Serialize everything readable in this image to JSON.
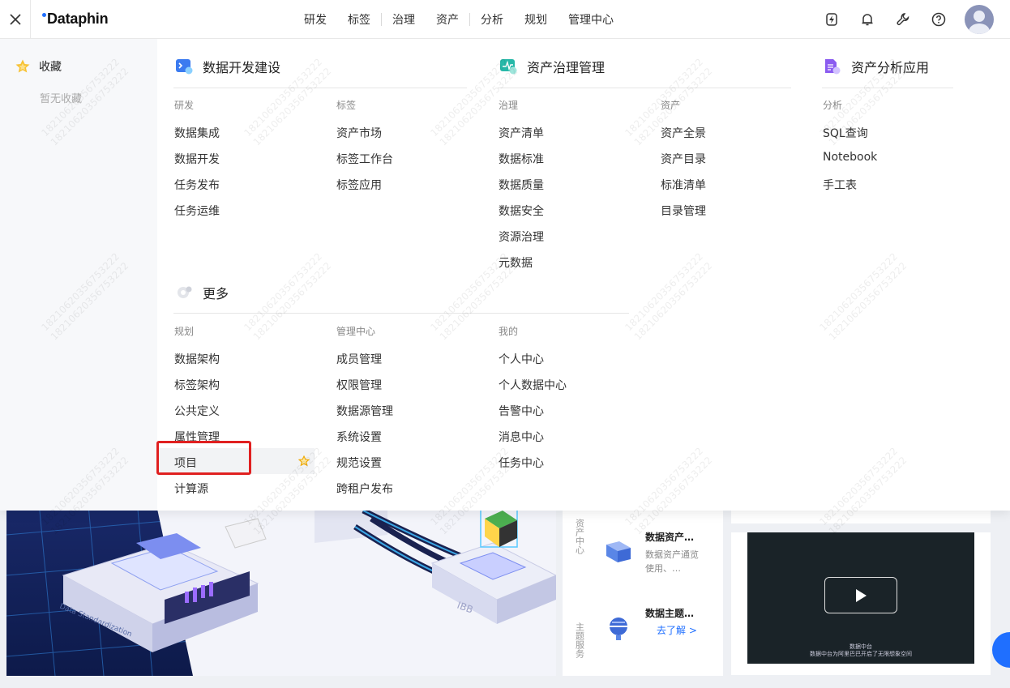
{
  "brand": {
    "logo_text": "Dataphin",
    "accent": "#1f6fff"
  },
  "nav": {
    "items": [
      "研发",
      "标签",
      "治理",
      "资产",
      "分析",
      "规划",
      "管理中心"
    ]
  },
  "top_icons": [
    "lightning-badge-icon",
    "bell-icon",
    "wrench-icon",
    "help-icon",
    "user-avatar"
  ],
  "favorites": {
    "title": "收藏",
    "empty_text": "暂无收藏"
  },
  "sections": {
    "dev": {
      "title": "数据开发建设",
      "groups": [
        {
          "label": "研发",
          "items": [
            "数据集成",
            "数据开发",
            "任务发布",
            "任务运维"
          ]
        },
        {
          "label": "标签",
          "items": [
            "资产市场",
            "标签工作台",
            "标签应用"
          ]
        }
      ]
    },
    "governance": {
      "title": "资产治理管理",
      "groups": [
        {
          "label": "治理",
          "items": [
            "资产清单",
            "数据标准",
            "数据质量",
            "数据安全",
            "资源治理",
            "元数据"
          ]
        },
        {
          "label": "资产",
          "items": [
            "资产全景",
            "资产目录",
            "标准清单",
            "目录管理"
          ]
        }
      ]
    },
    "analysis": {
      "title": "资产分析应用",
      "groups": [
        {
          "label": "分析",
          "items": [
            "SQL查询",
            "Notebook",
            "手工表"
          ]
        }
      ]
    },
    "more": {
      "title": "更多",
      "groups": [
        {
          "label": "规划",
          "items": [
            "数据架构",
            "标签架构",
            "公共定义",
            "属性管理",
            "项目",
            "计算源"
          ]
        },
        {
          "label": "管理中心",
          "items": [
            "成员管理",
            "权限管理",
            "数据源管理",
            "系统设置",
            "规范设置",
            "跨租户发布"
          ]
        },
        {
          "label": "我的",
          "items": [
            "个人中心",
            "个人数据中心",
            "告警中心",
            "消息中心",
            "任务中心"
          ]
        }
      ]
    }
  },
  "background": {
    "hero_texts": [
      "Data Standardization",
      "IBB"
    ],
    "side_label": "资产中心",
    "side_label_2": "主题服务",
    "cards": [
      {
        "title": "数据资产…",
        "desc": "数据资产通览使用、…"
      },
      {
        "title": "数据主题…",
        "link": "去了解 >"
      }
    ],
    "video_caption_1": "数据中台",
    "video_caption_2": "数据中台为阿里巴巴开启了无限想象空间"
  },
  "watermark_text": "18210620356753222"
}
